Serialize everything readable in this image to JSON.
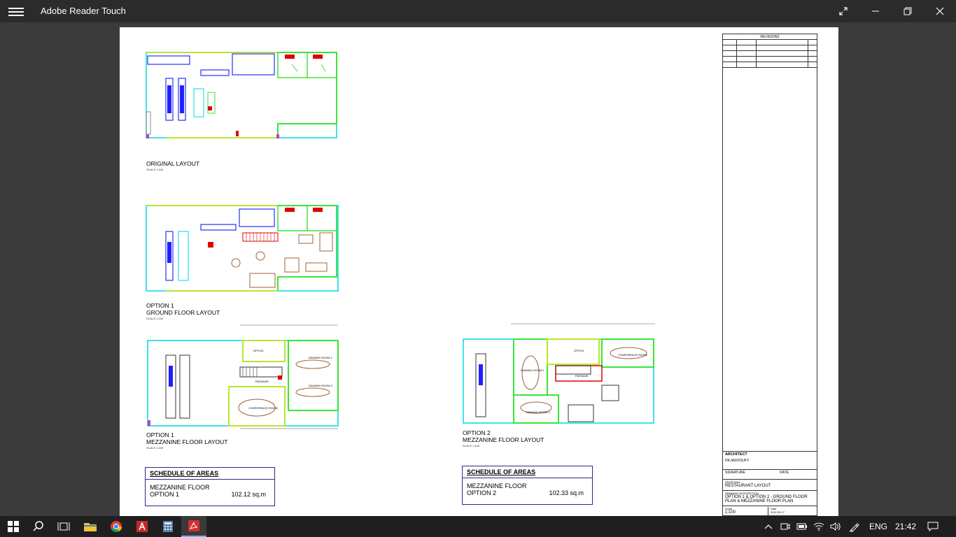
{
  "window": {
    "title": "Adobe Reader Touch"
  },
  "document": {
    "original": {
      "label": "ORIGINAL LAYOUT",
      "scale": "SCALE 1:100"
    },
    "option1_ground": {
      "label_line1": "OPTION 1",
      "label_line2": "GROUND FLOOR LAYOUT",
      "scale": "SCALE 1:100"
    },
    "option1_mezz": {
      "label_line1": "OPTION 1",
      "label_line2": "MEZZANINE FLOOR LAYOUT",
      "scale": "SCALE 1:100"
    },
    "option2_mezz": {
      "label_line1": "OPTION 2",
      "label_line2": "MEZZANINE FLOOR LAYOUT",
      "scale": "SCALE 1:100"
    },
    "rooms": {
      "office": "OFFICE",
      "dining1": "DINNING ROOM 1",
      "dining2": "DINNING ROOM 2",
      "conference": "CONFERENCE ROOM",
      "passage": "PASSAGE"
    },
    "schedule1": {
      "header": "SCHEDULE OF AREAS",
      "floor": "MEZZANINE FLOOR",
      "option": "OPTION 1",
      "area": "102.12 sq.m"
    },
    "schedule2": {
      "header": "SCHEDULE OF AREAS",
      "floor": "MEZZANINE FLOOR",
      "option": "OPTION 2",
      "area": "102.33 sq.m"
    },
    "titleblock": {
      "revisions": "REVISIONS",
      "architect_label": "ARCHITECT",
      "architect_name": "DK.MGOOUFY",
      "signature_label": "SIGNATURE",
      "date_label": "DATE",
      "proposal_label": "PROPOSAL",
      "proposal": "RESTAURANT LAYOUT",
      "drawing_desc_label": "DRAWING DESCRIPTION",
      "drawing_desc_1": "OPTION 1 & OPTION 2 - GROUND  FLOOR",
      "drawing_desc_2": "PLAN & MEZZANINE FLOOR PLAN",
      "scale_label": "Scale",
      "scale": "1:100",
      "date_field_label": "Date",
      "date": "2022.05.17"
    }
  },
  "taskbar": {
    "language": "ENG",
    "time": "21:42"
  },
  "colors": {
    "titlebar": "#2b2b2b",
    "viewer_bg": "#3b3b3b",
    "cyan": "#00d8e0",
    "green": "#39e639",
    "lime": "#b8e630",
    "blue": "#0000ff",
    "red": "#e00000",
    "magenta": "#c040c0"
  }
}
